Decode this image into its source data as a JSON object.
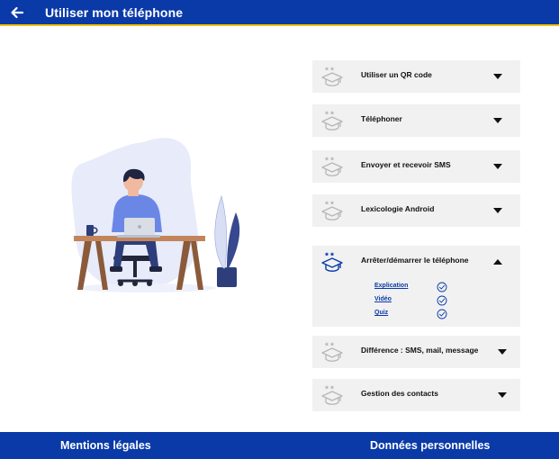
{
  "header": {
    "title": "Utiliser mon téléphone",
    "back_icon": "arrow-left-icon"
  },
  "colors": {
    "brand": "#0a3aa8",
    "accent_line": "#f2c300",
    "panel": "#f1f1f1",
    "inactive_icon": "#b7b7b7"
  },
  "accordion": {
    "items": [
      {
        "label": "Utiliser un QR code",
        "expanded": false
      },
      {
        "label": "Téléphoner",
        "expanded": false
      },
      {
        "label": "Envoyer et recevoir SMS",
        "expanded": false
      },
      {
        "label": "Lexicologie Android",
        "expanded": false
      },
      {
        "label": "Arrêter/démarrer le téléphone",
        "expanded": true,
        "sublinks": [
          {
            "label": "Explication",
            "done": true
          },
          {
            "label": "Vidéo",
            "done": true
          },
          {
            "label": "Quiz",
            "done": true
          }
        ]
      },
      {
        "label": "Différence : SMS, mail, message",
        "expanded": false
      },
      {
        "label": "Gestion des contacts",
        "expanded": false
      }
    ]
  },
  "footer": {
    "legal": "Mentions légales",
    "personal_data": "Données personnelles"
  }
}
